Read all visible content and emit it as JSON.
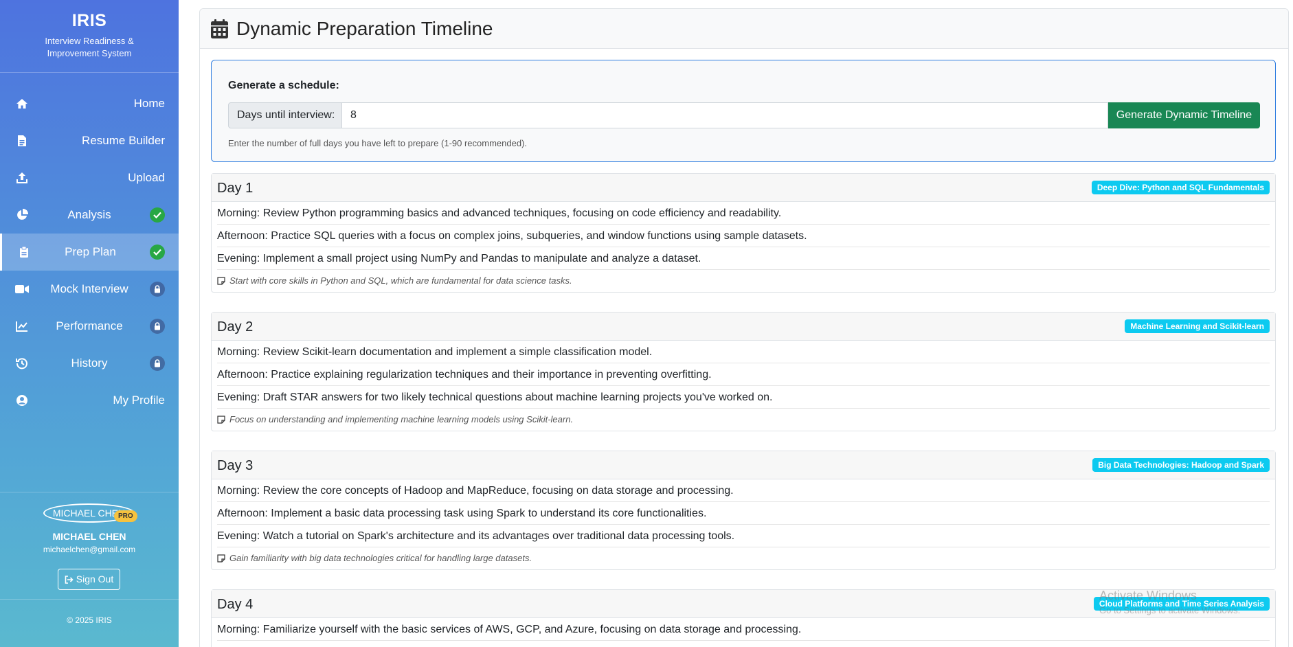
{
  "sidebar": {
    "brand_title": "IRIS",
    "brand_subtitle": "Interview Readiness & Improvement System",
    "items": [
      {
        "label": "Home",
        "icon": "home-icon"
      },
      {
        "label": "Resume Builder",
        "icon": "document-icon"
      },
      {
        "label": "Upload",
        "icon": "upload-icon"
      },
      {
        "label": "Analysis",
        "icon": "pie-chart-icon",
        "status": "completed"
      },
      {
        "label": "Prep Plan",
        "icon": "clipboard-icon",
        "status": "completed",
        "active": true
      },
      {
        "label": "Mock Interview",
        "icon": "video-icon",
        "status": "locked"
      },
      {
        "label": "Performance",
        "icon": "line-chart-icon",
        "status": "locked"
      },
      {
        "label": "History",
        "icon": "history-icon",
        "status": "locked"
      },
      {
        "label": "My Profile",
        "icon": "user-circle-icon"
      }
    ],
    "user": {
      "avatar_text": "MICHAEL CHEN",
      "badge": "PRO",
      "name": "MICHAEL CHEN",
      "email": "michaelchen@gmail.com",
      "signout_label": "Sign Out"
    },
    "copyright": "© 2025 IRIS"
  },
  "main": {
    "title": "Dynamic Preparation Timeline",
    "generator": {
      "heading": "Generate a schedule:",
      "input_label": "Days until interview:",
      "input_value": "8",
      "button_label": "Generate Dynamic Timeline",
      "help_text": "Enter the number of full days you have left to prepare (1-90 recommended)."
    },
    "days": [
      {
        "title": "Day 1",
        "tag": "Deep Dive: Python and SQL Fundamentals",
        "tasks": [
          "Morning: Review Python programming basics and advanced techniques, focusing on code efficiency and readability.",
          "Afternoon: Practice SQL queries with a focus on complex joins, subqueries, and window functions using sample datasets.",
          "Evening: Implement a small project using NumPy and Pandas to manipulate and analyze a dataset."
        ],
        "note": "Start with core skills in Python and SQL, which are fundamental for data science tasks."
      },
      {
        "title": "Day 2",
        "tag": "Machine Learning and Scikit-learn",
        "tasks": [
          "Morning: Review Scikit-learn documentation and implement a simple classification model.",
          "Afternoon: Practice explaining regularization techniques and their importance in preventing overfitting.",
          "Evening: Draft STAR answers for two likely technical questions about machine learning projects you've worked on."
        ],
        "note": "Focus on understanding and implementing machine learning models using Scikit-learn."
      },
      {
        "title": "Day 3",
        "tag": "Big Data Technologies: Hadoop and Spark",
        "tasks": [
          "Morning: Review the core concepts of Hadoop and MapReduce, focusing on data storage and processing.",
          "Afternoon: Implement a basic data processing task using Spark to understand its core functionalities.",
          "Evening: Watch a tutorial on Spark's architecture and its advantages over traditional data processing tools."
        ],
        "note": "Gain familiarity with big data technologies critical for handling large datasets."
      },
      {
        "title": "Day 4",
        "tag": "Cloud Platforms and Time Series Analysis",
        "tasks": [
          "Morning: Familiarize yourself with the basic services of AWS, GCP, and Azure, focusing on data storage and processing."
        ]
      }
    ]
  },
  "os_watermark": {
    "line1": "Activate Windows",
    "line2": "Go to Settings to activate Windows."
  }
}
